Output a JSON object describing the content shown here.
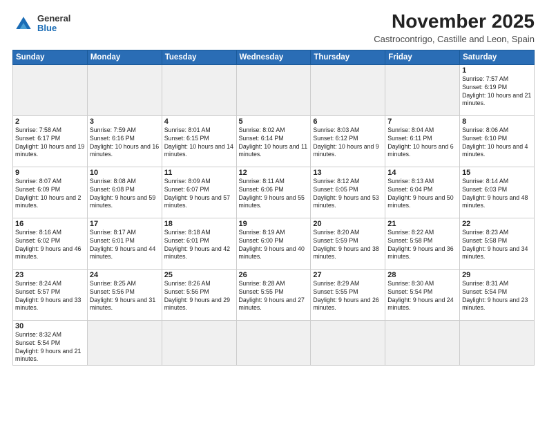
{
  "header": {
    "logo_general": "General",
    "logo_blue": "Blue",
    "month_title": "November 2025",
    "location": "Castrocontrigo, Castille and Leon, Spain"
  },
  "days_of_week": [
    "Sunday",
    "Monday",
    "Tuesday",
    "Wednesday",
    "Thursday",
    "Friday",
    "Saturday"
  ],
  "weeks": [
    [
      {
        "day": "",
        "info": ""
      },
      {
        "day": "",
        "info": ""
      },
      {
        "day": "",
        "info": ""
      },
      {
        "day": "",
        "info": ""
      },
      {
        "day": "",
        "info": ""
      },
      {
        "day": "",
        "info": ""
      },
      {
        "day": "1",
        "info": "Sunrise: 7:57 AM\nSunset: 6:19 PM\nDaylight: 10 hours and 21 minutes."
      }
    ],
    [
      {
        "day": "2",
        "info": "Sunrise: 7:58 AM\nSunset: 6:17 PM\nDaylight: 10 hours and 19 minutes."
      },
      {
        "day": "3",
        "info": "Sunrise: 7:59 AM\nSunset: 6:16 PM\nDaylight: 10 hours and 16 minutes."
      },
      {
        "day": "4",
        "info": "Sunrise: 8:01 AM\nSunset: 6:15 PM\nDaylight: 10 hours and 14 minutes."
      },
      {
        "day": "5",
        "info": "Sunrise: 8:02 AM\nSunset: 6:14 PM\nDaylight: 10 hours and 11 minutes."
      },
      {
        "day": "6",
        "info": "Sunrise: 8:03 AM\nSunset: 6:12 PM\nDaylight: 10 hours and 9 minutes."
      },
      {
        "day": "7",
        "info": "Sunrise: 8:04 AM\nSunset: 6:11 PM\nDaylight: 10 hours and 6 minutes."
      },
      {
        "day": "8",
        "info": "Sunrise: 8:06 AM\nSunset: 6:10 PM\nDaylight: 10 hours and 4 minutes."
      }
    ],
    [
      {
        "day": "9",
        "info": "Sunrise: 8:07 AM\nSunset: 6:09 PM\nDaylight: 10 hours and 2 minutes."
      },
      {
        "day": "10",
        "info": "Sunrise: 8:08 AM\nSunset: 6:08 PM\nDaylight: 9 hours and 59 minutes."
      },
      {
        "day": "11",
        "info": "Sunrise: 8:09 AM\nSunset: 6:07 PM\nDaylight: 9 hours and 57 minutes."
      },
      {
        "day": "12",
        "info": "Sunrise: 8:11 AM\nSunset: 6:06 PM\nDaylight: 9 hours and 55 minutes."
      },
      {
        "day": "13",
        "info": "Sunrise: 8:12 AM\nSunset: 6:05 PM\nDaylight: 9 hours and 53 minutes."
      },
      {
        "day": "14",
        "info": "Sunrise: 8:13 AM\nSunset: 6:04 PM\nDaylight: 9 hours and 50 minutes."
      },
      {
        "day": "15",
        "info": "Sunrise: 8:14 AM\nSunset: 6:03 PM\nDaylight: 9 hours and 48 minutes."
      }
    ],
    [
      {
        "day": "16",
        "info": "Sunrise: 8:16 AM\nSunset: 6:02 PM\nDaylight: 9 hours and 46 minutes."
      },
      {
        "day": "17",
        "info": "Sunrise: 8:17 AM\nSunset: 6:01 PM\nDaylight: 9 hours and 44 minutes."
      },
      {
        "day": "18",
        "info": "Sunrise: 8:18 AM\nSunset: 6:01 PM\nDaylight: 9 hours and 42 minutes."
      },
      {
        "day": "19",
        "info": "Sunrise: 8:19 AM\nSunset: 6:00 PM\nDaylight: 9 hours and 40 minutes."
      },
      {
        "day": "20",
        "info": "Sunrise: 8:20 AM\nSunset: 5:59 PM\nDaylight: 9 hours and 38 minutes."
      },
      {
        "day": "21",
        "info": "Sunrise: 8:22 AM\nSunset: 5:58 PM\nDaylight: 9 hours and 36 minutes."
      },
      {
        "day": "22",
        "info": "Sunrise: 8:23 AM\nSunset: 5:58 PM\nDaylight: 9 hours and 34 minutes."
      }
    ],
    [
      {
        "day": "23",
        "info": "Sunrise: 8:24 AM\nSunset: 5:57 PM\nDaylight: 9 hours and 33 minutes."
      },
      {
        "day": "24",
        "info": "Sunrise: 8:25 AM\nSunset: 5:56 PM\nDaylight: 9 hours and 31 minutes."
      },
      {
        "day": "25",
        "info": "Sunrise: 8:26 AM\nSunset: 5:56 PM\nDaylight: 9 hours and 29 minutes."
      },
      {
        "day": "26",
        "info": "Sunrise: 8:28 AM\nSunset: 5:55 PM\nDaylight: 9 hours and 27 minutes."
      },
      {
        "day": "27",
        "info": "Sunrise: 8:29 AM\nSunset: 5:55 PM\nDaylight: 9 hours and 26 minutes."
      },
      {
        "day": "28",
        "info": "Sunrise: 8:30 AM\nSunset: 5:54 PM\nDaylight: 9 hours and 24 minutes."
      },
      {
        "day": "29",
        "info": "Sunrise: 8:31 AM\nSunset: 5:54 PM\nDaylight: 9 hours and 23 minutes."
      }
    ],
    [
      {
        "day": "30",
        "info": "Sunrise: 8:32 AM\nSunset: 5:54 PM\nDaylight: 9 hours and 21 minutes."
      },
      {
        "day": "",
        "info": ""
      },
      {
        "day": "",
        "info": ""
      },
      {
        "day": "",
        "info": ""
      },
      {
        "day": "",
        "info": ""
      },
      {
        "day": "",
        "info": ""
      },
      {
        "day": "",
        "info": ""
      }
    ]
  ]
}
